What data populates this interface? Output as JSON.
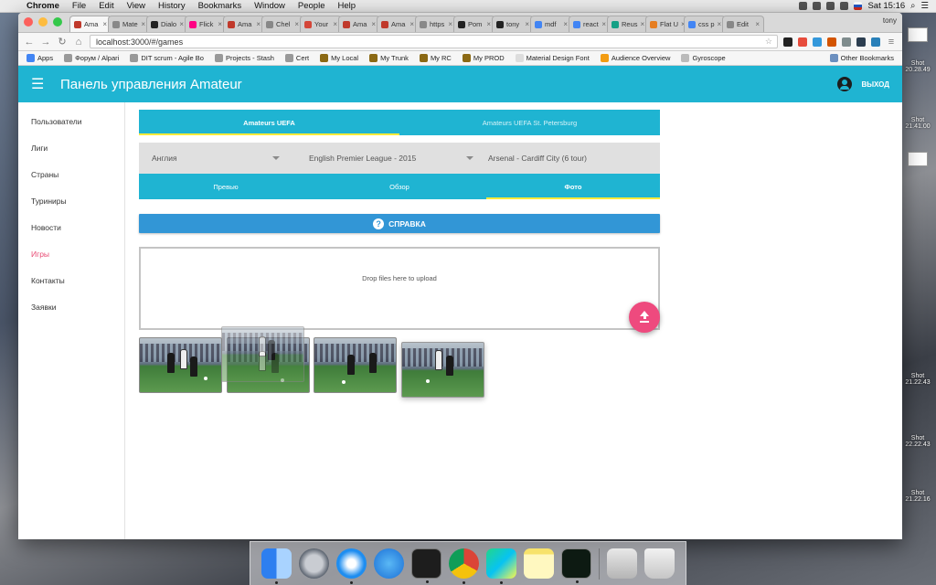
{
  "menubar": {
    "app": "Chrome",
    "menus": [
      "File",
      "Edit",
      "View",
      "History",
      "Bookmarks",
      "Window",
      "People",
      "Help"
    ],
    "time": "Sat 15:16"
  },
  "browser": {
    "tabs": [
      "Ama",
      "Mate",
      "Dialo",
      "Flick",
      "Ama",
      "Chel",
      "Your",
      "Ama",
      "Ama",
      "https",
      "Pom",
      "tony",
      "mdf",
      "react",
      "Reus",
      "Flat U",
      "css p",
      "Edit"
    ],
    "profile": "tony",
    "url": "localhost:3000/#/games",
    "bookmarks": [
      "Apps",
      "Форум / Alpari",
      "DIT scrum - Agile Bo",
      "Projects - Stash",
      "Cert",
      "My Local",
      "My Trunk",
      "My RC",
      "My PROD",
      "Material Design Font",
      "Audience Overview",
      "Gyroscope",
      "Other Bookmarks"
    ]
  },
  "appbar": {
    "title": "Панель управления Amateur",
    "logout_label": "выход"
  },
  "sidebar": {
    "items": [
      {
        "label": "Пользователи"
      },
      {
        "label": "Лиги"
      },
      {
        "label": "Страны"
      },
      {
        "label": "Туриниры"
      },
      {
        "label": "Новости"
      },
      {
        "label": "Игры"
      },
      {
        "label": "Контакты"
      },
      {
        "label": "Заявки"
      }
    ]
  },
  "league_tabs": [
    "Amateurs UEFA",
    "Amateurs UEFA St. Petersburg"
  ],
  "selects": {
    "country": "Англия",
    "season": "English Premier League - 2015",
    "match": "Arsenal - Cardiff City (6 tour)"
  },
  "game_tabs": [
    "Превью",
    "Обзор",
    "Фото"
  ],
  "help_label": "справка",
  "dropzone_text": "Drop files here to upload",
  "desktop": {
    "items": [
      "Shot",
      "20.28.49",
      "Shot",
      "21.41.00",
      "Shot",
      "21.22.43",
      "Shot",
      "22.22.43",
      "Shot",
      "21.22.16"
    ]
  }
}
